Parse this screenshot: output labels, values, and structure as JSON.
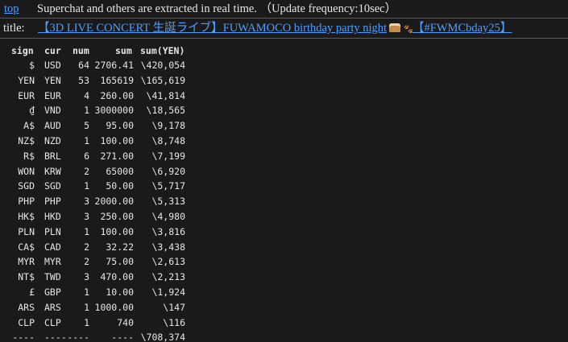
{
  "top": {
    "link_label": "top",
    "message": "Superchat and others are extracted in real time. （Update frequency:10sec）"
  },
  "title": {
    "label": "title:",
    "link_text": "【3D LIVE CONCERT 生誕ライブ】FUWAMOCO birthday party night",
    "link_suffix": "【#FWMCbday25】",
    "cake_icon": "cake-icon",
    "paw_icon": "paw-icon"
  },
  "table": {
    "headers": [
      "sign",
      "cur",
      "num",
      "sum",
      "sum(YEN)"
    ],
    "rows": [
      {
        "sign": "$",
        "cur": "USD",
        "num": "64",
        "sum": "2706.41",
        "yen": "\\420,054"
      },
      {
        "sign": "YEN",
        "cur": "YEN",
        "num": "53",
        "sum": "165619",
        "yen": "\\165,619"
      },
      {
        "sign": "EUR",
        "cur": "EUR",
        "num": "4",
        "sum": "260.00",
        "yen": "\\41,814"
      },
      {
        "sign": "₫",
        "cur": "VND",
        "num": "1",
        "sum": "3000000",
        "yen": "\\18,565"
      },
      {
        "sign": "A$",
        "cur": "AUD",
        "num": "5",
        "sum": "95.00",
        "yen": "\\9,178"
      },
      {
        "sign": "NZ$",
        "cur": "NZD",
        "num": "1",
        "sum": "100.00",
        "yen": "\\8,748"
      },
      {
        "sign": "R$",
        "cur": "BRL",
        "num": "6",
        "sum": "271.00",
        "yen": "\\7,199"
      },
      {
        "sign": "WON",
        "cur": "KRW",
        "num": "2",
        "sum": "65000",
        "yen": "\\6,920"
      },
      {
        "sign": "SGD",
        "cur": "SGD",
        "num": "1",
        "sum": "50.00",
        "yen": "\\5,717"
      },
      {
        "sign": "PHP",
        "cur": "PHP",
        "num": "3",
        "sum": "2000.00",
        "yen": "\\5,313"
      },
      {
        "sign": "HK$",
        "cur": "HKD",
        "num": "3",
        "sum": "250.00",
        "yen": "\\4,980"
      },
      {
        "sign": "PLN",
        "cur": "PLN",
        "num": "1",
        "sum": "100.00",
        "yen": "\\3,816"
      },
      {
        "sign": "CA$",
        "cur": "CAD",
        "num": "2",
        "sum": "32.22",
        "yen": "\\3,438"
      },
      {
        "sign": "MYR",
        "cur": "MYR",
        "num": "2",
        "sum": "75.00",
        "yen": "\\2,613"
      },
      {
        "sign": "NT$",
        "cur": "TWD",
        "num": "3",
        "sum": "470.00",
        "yen": "\\2,213"
      },
      {
        "sign": "£",
        "cur": "GBP",
        "num": "1",
        "sum": "10.00",
        "yen": "\\1,924"
      },
      {
        "sign": "ARS",
        "cur": "ARS",
        "num": "1",
        "sum": "1000.00",
        "yen": "\\147"
      },
      {
        "sign": "CLP",
        "cur": "CLP",
        "num": "1",
        "sum": "740",
        "yen": "\\116"
      }
    ],
    "footer": {
      "sign": "----",
      "cur": "----",
      "num": "----",
      "sum": "----",
      "yen": "\\708,374"
    }
  },
  "colors": {
    "background": "#1a1a1a",
    "text": "#e6e6e6",
    "link": "#4d9fff"
  }
}
